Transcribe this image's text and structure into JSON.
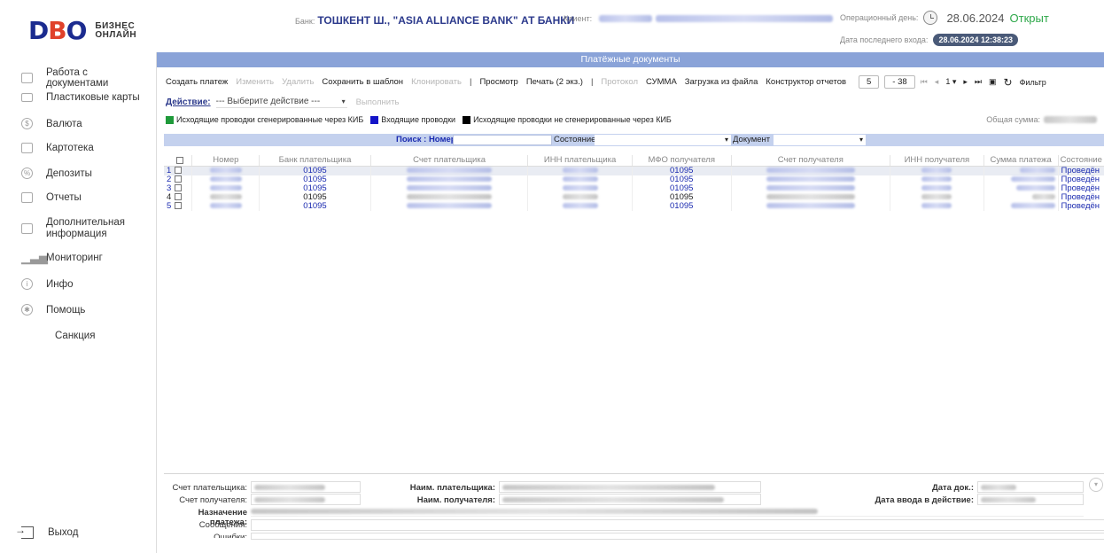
{
  "header": {
    "logo_main": "DBO",
    "logo_sub_1": "БИЗНЕС",
    "logo_sub_2": "ОНЛАЙН",
    "bank_label": "Банк:",
    "bank_name": "ТОШКЕНТ Ш., \"ASIA ALLIANCE BANK\" АТ БАНКИ",
    "client_label": "Клиент:",
    "op_day_label": "Операционный день:",
    "op_day_date": "28.06.2024",
    "op_day_status": "Открыт",
    "last_login_label": "Дата последнего входа:",
    "last_login_value": "28.06.2024 12:38:23"
  },
  "sidebar": {
    "items": [
      {
        "label": "Работа с документами",
        "icon": "documents-icon"
      },
      {
        "label": "Пластиковые карты",
        "icon": "card-icon"
      },
      {
        "label": "Валюта",
        "icon": "currency-icon"
      },
      {
        "label": "Картотека",
        "icon": "file-cabinet-icon"
      },
      {
        "label": "Депозиты",
        "icon": "deposit-icon"
      },
      {
        "label": "Отчеты",
        "icon": "reports-icon"
      },
      {
        "label": "Дополнительная",
        "label2": "информация",
        "icon": "info-box-icon"
      },
      {
        "label": "Мониторинг",
        "icon": "monitoring-icon"
      },
      {
        "label": "Инфо",
        "icon": "info-icon"
      },
      {
        "label": "Помощь",
        "icon": "help-icon"
      },
      {
        "label": "Санкция",
        "icon": ""
      }
    ],
    "exit_label": "Выход"
  },
  "panel": {
    "title": "Платёжные документы"
  },
  "toolbar": {
    "items": [
      {
        "label": "Создать платеж",
        "disabled": false
      },
      {
        "label": "Изменить",
        "disabled": true
      },
      {
        "label": "Удалить",
        "disabled": true
      },
      {
        "label": "Сохранить в шаблон",
        "disabled": false
      },
      {
        "label": "Клонировать",
        "disabled": true
      },
      {
        "label": "|",
        "sep": true
      },
      {
        "label": "Просмотр",
        "disabled": false
      },
      {
        "label": "Печать (2 экз.)",
        "disabled": false
      },
      {
        "label": "|",
        "sep": true
      },
      {
        "label": "Протокол",
        "disabled": true
      },
      {
        "label": "СУММА",
        "disabled": false
      },
      {
        "label": "Загрузка из файла",
        "disabled": false
      },
      {
        "label": "Конструктор отчетов",
        "disabled": false
      }
    ],
    "page_size": "5",
    "page_range": "- 38",
    "current_page": "1",
    "filter_label": "Фильтр"
  },
  "action": {
    "label": "Действие:",
    "select_value": "--- Выберите действие ---",
    "execute_label": "Выполнить"
  },
  "legend": {
    "items": [
      {
        "label": "Исходящие проводки сгенерированные через КИБ",
        "color": "#1f9a3a"
      },
      {
        "label": "Входящие проводки",
        "color": "#1414c8"
      },
      {
        "label": "Исходящие проводки не сгенерированные через КИБ",
        "color": "#000000"
      }
    ],
    "total_label": "Общая сумма:"
  },
  "search": {
    "label": "Поиск : Номер",
    "state_label": "Состояние",
    "document_label": "Документ"
  },
  "table": {
    "headers": [
      "Номер",
      "Банк плательщика",
      "Счет плательщика",
      "ИНН плательщика",
      "МФО получателя",
      "Счет получателя",
      "ИНН получателя",
      "Сумма платежа",
      "Состояние"
    ],
    "rows": [
      {
        "n": "1",
        "bank": "01095",
        "mfo": "01095",
        "state": "Проведён",
        "color": "blue"
      },
      {
        "n": "2",
        "bank": "01095",
        "mfo": "01095",
        "state": "Проведён",
        "color": "blue"
      },
      {
        "n": "3",
        "bank": "01095",
        "mfo": "01095",
        "state": "Проведён",
        "color": "blue"
      },
      {
        "n": "4",
        "bank": "01095",
        "mfo": "01095",
        "state": "Проведён",
        "color": "black"
      },
      {
        "n": "5",
        "bank": "01095",
        "mfo": "01095",
        "state": "Проведён",
        "color": "blue"
      }
    ]
  },
  "details": {
    "payer_account_label": "Счет плательщика:",
    "recipient_account_label": "Счет получателя:",
    "purpose_label": "Назначение платежа:",
    "messages_label": "Сообщения:",
    "errors_label": "Ошибки:",
    "payer_name_label": "Наим. плательщика:",
    "recipient_name_label": "Наим. получателя:",
    "doc_date_label": "Дата док.:",
    "effective_date_label": "Дата ввода в действие:"
  }
}
